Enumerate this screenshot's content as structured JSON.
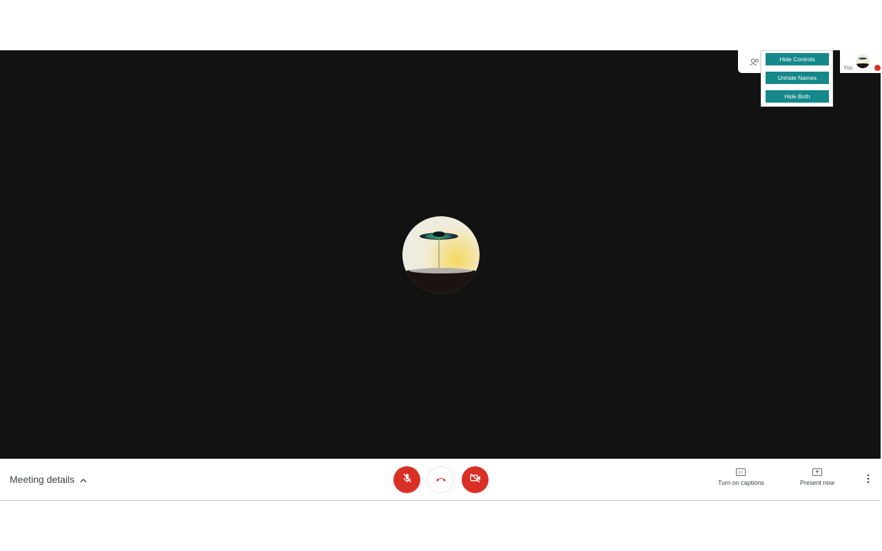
{
  "main": {
    "participant_avatar": "droplet-image"
  },
  "top_right": {
    "self_label": "You",
    "people_icon": "people-icon"
  },
  "extension_panel": {
    "buttons": [
      {
        "label": "Hide Controls"
      },
      {
        "label": "Unhide Names"
      },
      {
        "label": "Hide Both"
      }
    ],
    "button_color": "#14888a"
  },
  "toolbar": {
    "meeting_details_label": "Meeting details",
    "mic_icon": "mic-off-icon",
    "hangup_icon": "hang-up-icon",
    "camera_icon": "camera-off-icon",
    "captions_label": "Turn on captions",
    "present_label": "Present now",
    "more_icon": "more-vert-icon"
  },
  "colors": {
    "stage_background": "#121212",
    "danger": "#d93025"
  }
}
